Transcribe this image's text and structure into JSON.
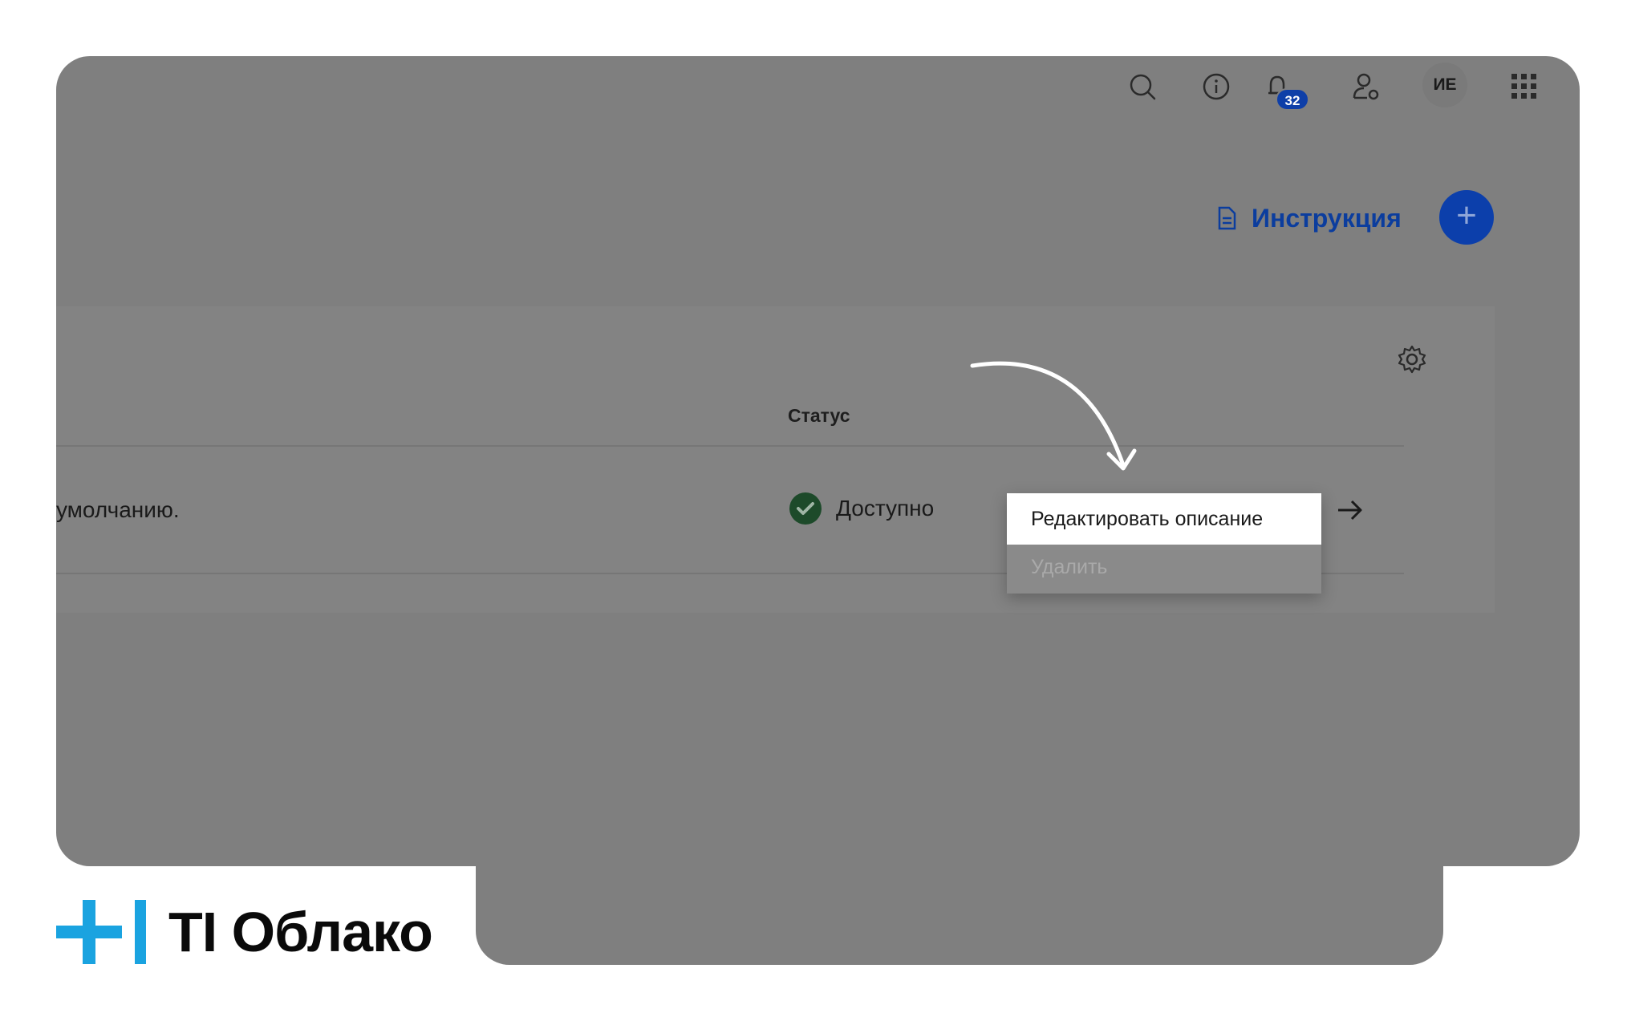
{
  "header": {
    "icons": [
      "search-icon",
      "info-icon",
      "bell-icon",
      "user-settings-icon",
      "apps-grid-icon"
    ],
    "notifications_count": "32",
    "avatar_initials": "ИЕ"
  },
  "toolbar": {
    "instruction_label": "Инструкция",
    "add_label": "+"
  },
  "table": {
    "status_header": "Статус",
    "row": {
      "description": "умолчанию.",
      "status": "Доступно"
    }
  },
  "context_menu": {
    "items": [
      "Редактировать описание",
      "Удалить"
    ]
  },
  "logo": {
    "text": "TI Облако"
  },
  "colors": {
    "overlay": "#7f7f7f",
    "accent": "#0c3fab",
    "success": "#1d4a2a",
    "logo_blue": "#1aa3e0"
  }
}
